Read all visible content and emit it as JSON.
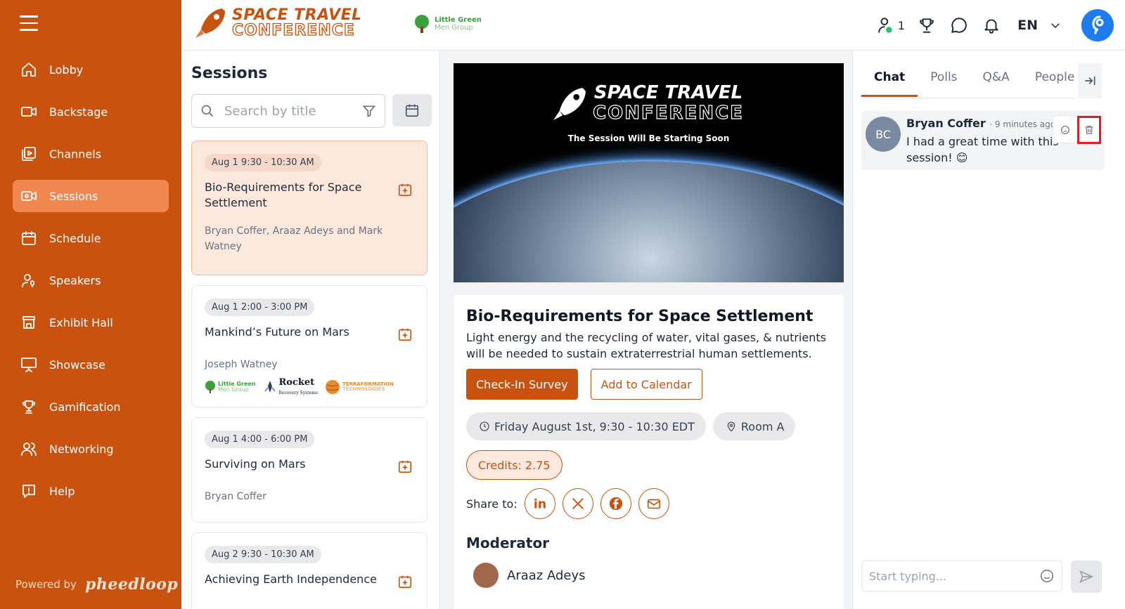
{
  "sidebar": {
    "items": [
      {
        "label": "Lobby",
        "icon": "home-icon"
      },
      {
        "label": "Backstage",
        "icon": "video-camera-icon"
      },
      {
        "label": "Channels",
        "icon": "channels-icon"
      },
      {
        "label": "Sessions",
        "icon": "sessions-icon",
        "active": true
      },
      {
        "label": "Schedule",
        "icon": "calendar-icon"
      },
      {
        "label": "Speakers",
        "icon": "speaker-icon"
      },
      {
        "label": "Exhibit Hall",
        "icon": "booth-icon"
      },
      {
        "label": "Showcase",
        "icon": "presentation-icon"
      },
      {
        "label": "Gamification",
        "icon": "trophy-icon"
      },
      {
        "label": "Networking",
        "icon": "people-icon"
      },
      {
        "label": "Help",
        "icon": "help-icon"
      }
    ],
    "powered_by": "Powered by",
    "powered_brand": "pheedloop"
  },
  "header": {
    "logo_line1": "SPACE TRAVEL",
    "logo_line2": "CONFERENCE",
    "sponsor_line1": "Little Green",
    "sponsor_line2": "Men Group",
    "online_count": "1",
    "language": "EN"
  },
  "sessions": {
    "title": "Sessions",
    "search_placeholder": "Search by title",
    "cards": [
      {
        "time": "Aug 1 9:30 - 10:30 AM",
        "title": "Bio-Requirements for Space Settlement",
        "speakers": "Bryan Coffer, Araaz Adeys and Mark Watney",
        "active": true
      },
      {
        "time": "Aug 1 2:00 - 3:00 PM",
        "title": "Mankind’s Future on Mars",
        "speakers": "Joseph Watney"
      },
      {
        "time": "Aug 1 4:00 - 6:00 PM",
        "title": "Surviving on Mars",
        "speakers": "Bryan Coffer"
      },
      {
        "time": "Aug 2 9:30 - 10:30 AM",
        "title": "Achieving Earth Independence",
        "speakers": ""
      }
    ],
    "sponsors": {
      "s1_line1": "Little Green",
      "s1_line2": "Men Group",
      "s2_line1": "Rocket",
      "s2_line2": "Recovery Systems",
      "s3_line1": "TERRAFORMATION",
      "s3_line2": "TECHNOLOGIES"
    }
  },
  "video": {
    "line1": "SPACE TRAVEL",
    "line2": "CONFERENCE",
    "subtitle": "The Session Will Be Starting Soon"
  },
  "detail": {
    "title": "Bio-Requirements for Space Settlement",
    "description": "Light energy and the recycling of water, vital gases, & nutrients will be needed to sustain extraterrestrial human settlements.",
    "checkin_label": "Check-In Survey",
    "calendar_label": "Add to Calendar",
    "datetime": "Friday August 1st, 9:30 - 10:30 EDT",
    "room": "Room A",
    "credits": "Credits: 2.75",
    "share_label": "Share to:",
    "moderator_heading": "Moderator",
    "moderator_name": "Araaz Adeys"
  },
  "chat": {
    "tabs": [
      "Chat",
      "Polls",
      "Q&A",
      "People"
    ],
    "message": {
      "initials": "BC",
      "author": "Bryan Coffer",
      "ago": "· 9 minutes ago",
      "text": "I had a great time with this session! 😊"
    },
    "composer_placeholder": "Start typing..."
  },
  "colors": {
    "brand": "#c9520f",
    "brand_light": "#f0874f",
    "avatar_blue": "#1e7cf0",
    "highlight": "#e11d2a"
  }
}
